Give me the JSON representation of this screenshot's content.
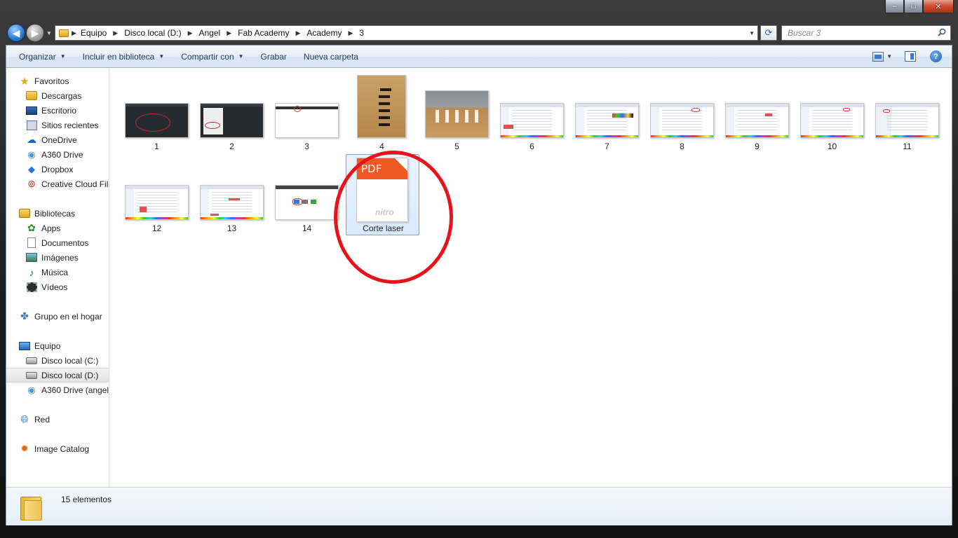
{
  "window": {
    "controls": {
      "minimize": "–",
      "maximize": "□",
      "close": "✕"
    }
  },
  "address": {
    "crumbs": [
      "Equipo",
      "Disco local (D:)",
      "Angel",
      "Fab Academy",
      "Academy",
      "3"
    ],
    "search_placeholder": "Buscar 3"
  },
  "toolbar": {
    "organize": "Organizar",
    "include_library": "Incluir en biblioteca",
    "share": "Compartir con",
    "burn": "Grabar",
    "new_folder": "Nueva carpeta"
  },
  "sidebar": {
    "favorites": {
      "label": "Favoritos",
      "items": [
        "Descargas",
        "Escritorio",
        "Sitios recientes",
        "OneDrive",
        "A360 Drive",
        "Dropbox",
        "Creative Cloud Files"
      ]
    },
    "libraries": {
      "label": "Bibliotecas",
      "items": [
        "Apps",
        "Documentos",
        "Imágenes",
        "Música",
        "Vídeos"
      ]
    },
    "homegroup": {
      "label": "Grupo en el hogar"
    },
    "computer": {
      "label": "Equipo",
      "items": [
        "Disco local (C:)",
        "Disco local (D:)",
        "A360 Drive (angel."
      ],
      "selected": "Disco local (D:)"
    },
    "network": {
      "label": "Red"
    },
    "image_catalog": {
      "label": "Image Catalog"
    }
  },
  "files": {
    "items": [
      {
        "name": "1",
        "kind": "cad-screenshot"
      },
      {
        "name": "2",
        "kind": "cad-screenshot"
      },
      {
        "name": "3",
        "kind": "screenshot"
      },
      {
        "name": "4",
        "kind": "photo"
      },
      {
        "name": "5",
        "kind": "photo"
      },
      {
        "name": "6",
        "kind": "screenshot"
      },
      {
        "name": "7",
        "kind": "screenshot"
      },
      {
        "name": "8",
        "kind": "screenshot"
      },
      {
        "name": "9",
        "kind": "screenshot"
      },
      {
        "name": "10",
        "kind": "screenshot"
      },
      {
        "name": "11",
        "kind": "screenshot"
      },
      {
        "name": "12",
        "kind": "screenshot"
      },
      {
        "name": "13",
        "kind": "screenshot"
      },
      {
        "name": "14",
        "kind": "screenshot"
      }
    ],
    "pdf": {
      "name": "Corte laser",
      "badge": "PDF",
      "brand": "nitro"
    }
  },
  "details": {
    "count": "15 elementos"
  },
  "colors": {
    "annotation_circle": "#e8121a",
    "pdf_orange": "#ef5a24"
  }
}
